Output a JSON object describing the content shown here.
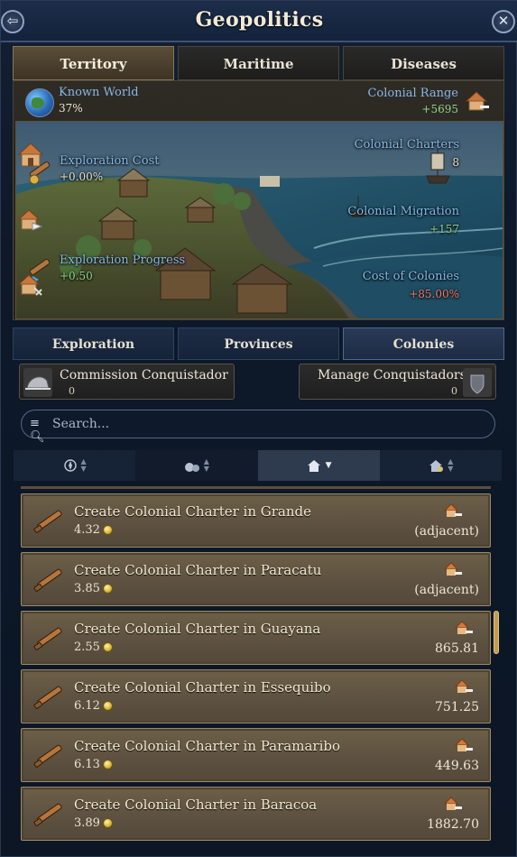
{
  "header": {
    "title": "Geopolitics",
    "back_glyph": "⇦",
    "close_glyph": "✕"
  },
  "main_tabs": [
    {
      "label": "Territory",
      "active": true
    },
    {
      "label": "Maritime",
      "active": false
    },
    {
      "label": "Diseases",
      "active": false
    }
  ],
  "territory": {
    "known_world": {
      "label": "Known World",
      "value": "37%"
    },
    "colonial_range": {
      "label": "Colonial Range",
      "value": "+5695"
    },
    "exploration_cost": {
      "label": "Exploration Cost",
      "value": "+0.00%"
    },
    "exploration_progress": {
      "label": "Exploration Progress",
      "value": "+0.50"
    },
    "colonial_charters": {
      "label": "Colonial Charters",
      "value": "8"
    },
    "colonial_migration": {
      "label": "Colonial Migration",
      "value": "+157"
    },
    "cost_of_colonies": {
      "label": "Cost of Colonies",
      "value": "+85.00%"
    }
  },
  "sub_tabs": [
    {
      "label": "Exploration",
      "active": false
    },
    {
      "label": "Provinces",
      "active": false
    },
    {
      "label": "Colonies",
      "active": true
    }
  ],
  "commission": {
    "label": "Commission Conquistador",
    "count": "0"
  },
  "manage": {
    "label": "Manage Conquistadors",
    "count": "0"
  },
  "search": {
    "placeholder": "Search..."
  },
  "sort_columns": [
    {
      "icon": "compass-sort-icon",
      "active": false
    },
    {
      "icon": "money-bags-sort-icon",
      "active": false
    },
    {
      "icon": "house-distance-sort-icon",
      "active": true
    },
    {
      "icon": "house-coin-sort-icon",
      "active": false
    }
  ],
  "colonies": [
    {
      "name": "Create Colonial Charter in Grande",
      "cost": "4.32",
      "distance": "(adjacent)"
    },
    {
      "name": "Create Colonial Charter in Paracatu",
      "cost": "3.85",
      "distance": "(adjacent)"
    },
    {
      "name": "Create Colonial Charter in Guayana",
      "cost": "2.55",
      "distance": "865.81"
    },
    {
      "name": "Create Colonial Charter in Essequibo",
      "cost": "6.12",
      "distance": "751.25"
    },
    {
      "name": "Create Colonial Charter in Paramaribo",
      "cost": "6.13",
      "distance": "449.63"
    },
    {
      "name": "Create Colonial Charter in Baracoa",
      "cost": "3.89",
      "distance": "1882.70"
    }
  ],
  "colors": {
    "positive": "#8ed48a",
    "negative": "#f07a6a",
    "label_blue": "#86b8e8"
  }
}
